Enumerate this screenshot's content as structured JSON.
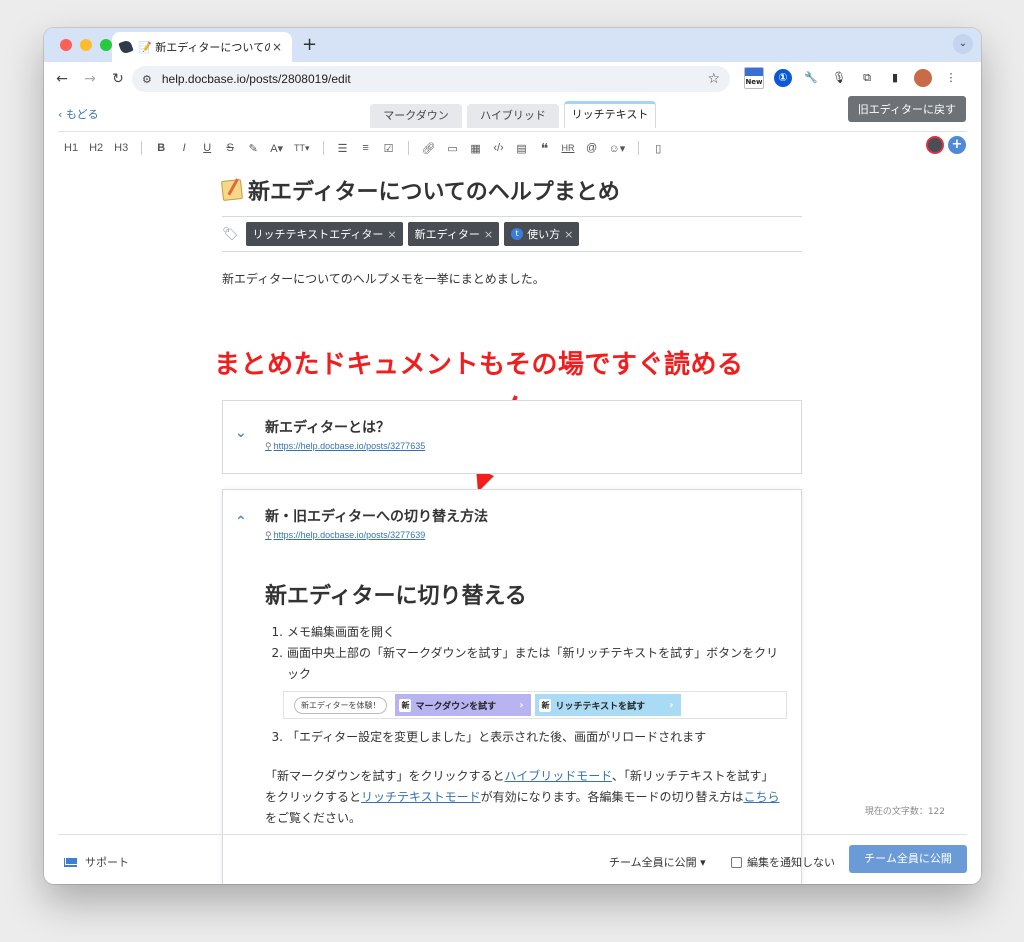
{
  "browser": {
    "tab_title": "📝 新エディターについてのヘル",
    "tab_close": "×",
    "new_tab": "+",
    "url": "help.docbase.io/posts/2808019/edit",
    "ext_new_label": "New"
  },
  "editor": {
    "back_label": "もどる",
    "mode_tabs": [
      {
        "label": "マークダウン"
      },
      {
        "label": "ハイブリッド"
      },
      {
        "label": "リッチテキスト"
      }
    ],
    "old_editor_label": "旧エディターに戻す",
    "toolbar": {
      "h1": "H1",
      "h2": "H2",
      "h3": "H3",
      "bold": "B",
      "italic": "I",
      "underline": "U",
      "strike": "S",
      "font_color": "A▾",
      "font_size": "TT▾",
      "hr": "HR",
      "mention": "@",
      "emoji": "☺▾"
    }
  },
  "doc": {
    "title": "新エディターについてのヘルプまとめ",
    "tags": [
      {
        "label": "リッチテキストエディター"
      },
      {
        "label": "新エディター"
      },
      {
        "label": "使い方",
        "badge": "t"
      }
    ],
    "intro": "新エディターについてのヘルプメモを一挙にまとめました。"
  },
  "annotation": "まとめたドキュメントもその場ですぐ読める",
  "embeds": [
    {
      "title": "新エディターとは？",
      "link": "https://help.docbase.io/posts/3277635"
    },
    {
      "title": "新・旧エディターへの切り替え方法",
      "link": "https://help.docbase.io/posts/3277639",
      "heading": "新エディターに切り替える",
      "steps": [
        {
          "num": "1.",
          "text": "メモ編集画面を開く"
        },
        {
          "num": "2.",
          "text": "画面中央上部の「新マークダウンを試す」または「新リッチテキストを試す」ボタンをクリック"
        },
        {
          "num": "3.",
          "text": "「エディター設定を変更しました」と表示された後、画面がリロードされます"
        }
      ],
      "step_image": {
        "pill": "新エディターを体験！",
        "new_char": "新",
        "md_button": "マークダウンを試す",
        "rt_button": "リッチテキストを試す"
      },
      "para": {
        "p1": "「新マークダウンを試す」をクリックすると",
        "link1": "ハイブリッドモード",
        "p2": "、「新リッチテキストを試す」をクリックすると",
        "link2": "リッチテキストモード",
        "p3": "が有効になります。各編集モードの切り替え方は",
        "link3": "こちら",
        "p4": "をご覧ください。"
      }
    }
  ],
  "char_count": "現在の文字数：122",
  "footer": {
    "support": "サポート",
    "publish_scope": "チーム全員に公開 ▾",
    "notify_label": "編集を通知しない",
    "publish_button": "チーム全員に公開"
  },
  "colors": {
    "annotation": "#f21d1d",
    "link": "#3572b0",
    "publish_button": "#6b9bd6",
    "active_tab_indicator": "#a4d4f4"
  }
}
